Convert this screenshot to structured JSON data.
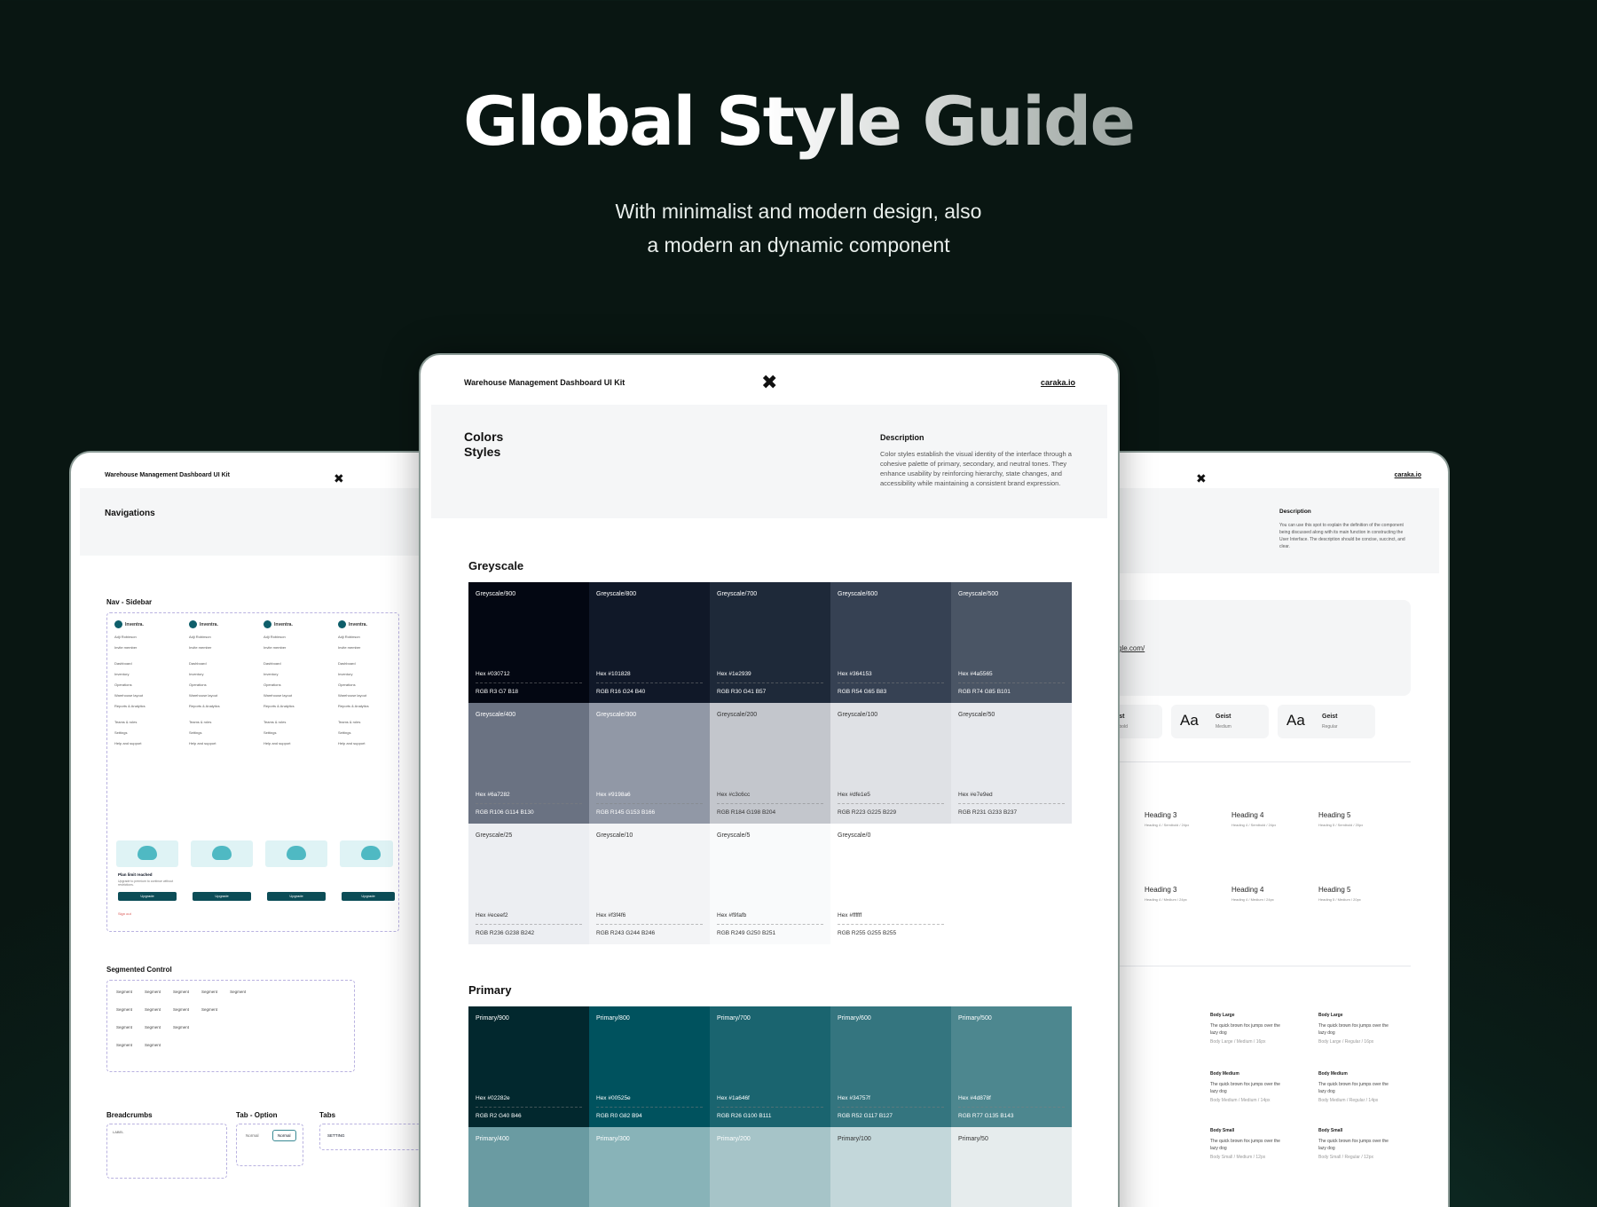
{
  "hero": {
    "title": "Global Style Guide",
    "subtitle_line1": "With minimalist and modern design, also",
    "subtitle_line2": "a modern an dynamic component"
  },
  "center": {
    "brand": "Warehouse Management Dashboard UI Kit",
    "link": "caraka.io",
    "section_title_line1": "Colors",
    "section_title_line2": "Styles",
    "description_heading": "Description",
    "description": "Color styles establish the visual identity of the interface through a cohesive palette of primary, secondary, and neutral tones. They enhance usability by reinforcing hierarchy, state changes, and accessibility while maintaining a consistent brand expression.",
    "greyscale_title": "Greyscale",
    "primary_title": "Primary",
    "greyscale": [
      {
        "name": "Greyscale/900",
        "hex": "Hex  #030712",
        "rgb": "RGB   R3  G7  B18",
        "color": "#030712",
        "tone": "dark"
      },
      {
        "name": "Greyscale/800",
        "hex": "Hex  #101828",
        "rgb": "RGB   R16  G24  B40",
        "color": "#101828",
        "tone": "dark"
      },
      {
        "name": "Greyscale/700",
        "hex": "Hex  #1e2939",
        "rgb": "RGB   R30  G41  B57",
        "color": "#1e2939",
        "tone": "dark"
      },
      {
        "name": "Greyscale/600",
        "hex": "Hex  #364153",
        "rgb": "RGB   R54  G65  B83",
        "color": "#364153",
        "tone": "dark"
      },
      {
        "name": "Greyscale/500",
        "hex": "Hex  #4a5565",
        "rgb": "RGB   R74  G85  B101",
        "color": "#4a5565",
        "tone": "dark"
      },
      {
        "name": "Greyscale/400",
        "hex": "Hex  #6a7282",
        "rgb": "RGB   R106  G114  B130",
        "color": "#6a7282",
        "tone": "dark"
      },
      {
        "name": "Greyscale/300",
        "hex": "Hex  #9198a6",
        "rgb": "RGB   R145  G153  B166",
        "color": "#9198a6",
        "tone": "dark"
      },
      {
        "name": "Greyscale/200",
        "hex": "Hex  #c3c6cc",
        "rgb": "RGB   R184  G198  B204",
        "color": "#c3c6cc",
        "tone": "light"
      },
      {
        "name": "Greyscale/100",
        "hex": "Hex  #dfe1e5",
        "rgb": "RGB   R223  G225  B229",
        "color": "#dfe1e5",
        "tone": "light"
      },
      {
        "name": "Greyscale/50",
        "hex": "Hex  #e7e9ed",
        "rgb": "RGB   R231  G233  B237",
        "color": "#e7e9ed",
        "tone": "light"
      },
      {
        "name": "Greyscale/25",
        "hex": "Hex  #eceef2",
        "rgb": "RGB   R236  G238  B242",
        "color": "#eceef2",
        "tone": "light"
      },
      {
        "name": "Greyscale/10",
        "hex": "Hex  #f3f4f6",
        "rgb": "RGB   R243  G244  B246",
        "color": "#f3f4f6",
        "tone": "light"
      },
      {
        "name": "Greyscale/5",
        "hex": "Hex  #f9fafb",
        "rgb": "RGB   R249  G250  B251",
        "color": "#f9fafb",
        "tone": "light"
      },
      {
        "name": "Greyscale/0",
        "hex": "Hex  #ffffff",
        "rgb": "RGB   R255  G255  B255",
        "color": "#ffffff",
        "tone": "light"
      }
    ],
    "primary": [
      {
        "name": "Primary/900",
        "hex": "Hex  #02282e",
        "rgb": "RGB   R2  G40  B46",
        "color": "#02282e",
        "tone": "dark"
      },
      {
        "name": "Primary/800",
        "hex": "Hex  #00525e",
        "rgb": "RGB   R0  G82  B94",
        "color": "#00525e",
        "tone": "dark"
      },
      {
        "name": "Primary/700",
        "hex": "Hex  #1a646f",
        "rgb": "RGB   R26  G100  B111",
        "color": "#1a646f",
        "tone": "dark"
      },
      {
        "name": "Primary/600",
        "hex": "Hex  #34757f",
        "rgb": "RGB   R52  G117  B127",
        "color": "#34757f",
        "tone": "dark"
      },
      {
        "name": "Primary/500",
        "hex": "Hex  #4d878f",
        "rgb": "RGB   R77  G135  B143",
        "color": "#4d878f",
        "tone": "dark"
      },
      {
        "name": "Primary/400",
        "hex": "",
        "rgb": "",
        "color": "#6a9ba2",
        "tone": "dark"
      },
      {
        "name": "Primary/300",
        "hex": "",
        "rgb": "",
        "color": "#88b3b8",
        "tone": "dark"
      },
      {
        "name": "Primary/200",
        "hex": "",
        "rgb": "",
        "color": "#a6c4c8",
        "tone": "dark"
      },
      {
        "name": "Primary/100",
        "hex": "",
        "rgb": "",
        "color": "#c3d7da",
        "tone": "light"
      },
      {
        "name": "Primary/50",
        "hex": "",
        "rgb": "",
        "color": "#e6eced",
        "tone": "light"
      }
    ]
  },
  "left": {
    "brand": "Warehouse Management Dashboard UI Kit",
    "section_title": "Navigations",
    "nav_sidebar": "Nav - Sidebar",
    "app_name": "Inventra.",
    "user": "Adji Robinson",
    "invite": "Invite member",
    "nav_items": [
      "Dashboard",
      "Inventory",
      "Operations",
      "Warehouse layout",
      "Reports & Analytics"
    ],
    "other_items": [
      "Teams & roles",
      "Settings",
      "Help and support"
    ],
    "plan_title": "Plan limit reached",
    "plan_text": "Upgrade to premium to continue without restrictions.",
    "upgrade": "Upgrade",
    "sign_out": "Sign out",
    "segmented_title": "Segmented Control",
    "segment": "Segment",
    "breadcrumbs_title": "Breadcrumbs",
    "breadcrumb_label": "LABEL",
    "tab_option_title": "Tab - Option",
    "tab_normal": "Normal",
    "tabs_title": "Tabs",
    "tab_setting": "SETTING"
  },
  "right": {
    "link": "caraka.io",
    "description_heading": "Description",
    "description": "You can use this spot to explain the definition of the component being discussed along with its main function in constructing the User Interface. The description should be concise, succinct, and clear.",
    "url_fragment": "gle.com/",
    "fonts": [
      {
        "aa": "a",
        "family": "Geist",
        "weight": "Semibold"
      },
      {
        "aa": "Aa",
        "family": "Geist",
        "weight": "Medium"
      },
      {
        "aa": "Aa",
        "family": "Geist",
        "weight": "Regular"
      }
    ],
    "headings": [
      {
        "label": "Heading 3",
        "spec": "Heading 4 / Semibold / 24px"
      },
      {
        "label": "Heading 4",
        "spec": "Heading 4 / Semibold / 24px"
      },
      {
        "label": "Heading 5",
        "spec": "Heading 5 / Semibold / 20px"
      },
      {
        "label": "Heading 3",
        "spec": "Heading 4 / Medium / 24px"
      },
      {
        "label": "Heading 4",
        "spec": "Heading 4 / Medium / 24px"
      },
      {
        "label": "Heading 5",
        "spec": "Heading 5 / Medium / 20px"
      }
    ],
    "bodies": [
      {
        "label": "Body Large",
        "text": "The quick brown fox jumps over the lazy dog",
        "spec": "Body Large / Medium / 16px"
      },
      {
        "label": "Body Large",
        "text": "The quick brown fox jumps over the lazy dog",
        "spec": "Body Large / Regular / 16px"
      },
      {
        "label": "Body Medium",
        "text": "The quick brown fox jumps over the lazy dog",
        "spec": "Body Medium / Medium / 14px"
      },
      {
        "label": "Body Medium",
        "text": "The quick brown fox jumps over the lazy dog",
        "spec": "Body Medium / Regular / 14px"
      },
      {
        "label": "Body Small",
        "text": "The quick brown fox jumps over the lazy dog",
        "spec": "Body Small / Medium / 12px"
      },
      {
        "label": "Body Small",
        "text": "The quick brown fox jumps over the lazy dog",
        "spec": "Body Small / Regular / 12px"
      }
    ]
  }
}
